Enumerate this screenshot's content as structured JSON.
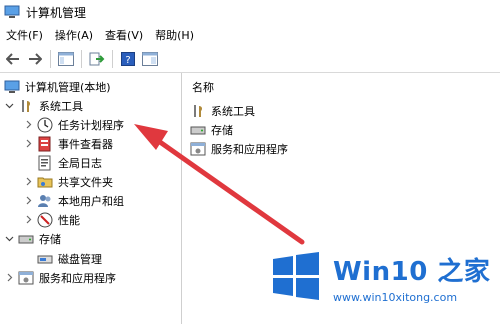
{
  "window": {
    "title": "计算机管理"
  },
  "menu": [
    {
      "label": "文件(F)"
    },
    {
      "label": "操作(A)"
    },
    {
      "label": "查看(V)"
    },
    {
      "label": "帮助(H)"
    }
  ],
  "toolbar": [
    {
      "name": "back-icon"
    },
    {
      "name": "forward-icon"
    },
    {
      "name": "show-hide-tree-icon"
    },
    {
      "name": "export-list-icon"
    },
    {
      "name": "help-icon"
    },
    {
      "name": "properties-pane-icon"
    }
  ],
  "tree": {
    "root": {
      "label": "计算机管理(本地)"
    },
    "system_tools": {
      "label": "系统工具"
    },
    "task_scheduler": {
      "label": "任务计划程序"
    },
    "event_viewer": {
      "label": "事件查看器"
    },
    "global_log": {
      "label": "全局日志"
    },
    "shared_folders": {
      "label": "共享文件夹"
    },
    "local_users": {
      "label": "本地用户和组"
    },
    "performance": {
      "label": "性能"
    },
    "storage": {
      "label": "存储"
    },
    "disk_management": {
      "label": "磁盘管理"
    },
    "services_apps": {
      "label": "服务和应用程序"
    }
  },
  "list": {
    "header": "名称",
    "items": [
      {
        "label": "系统工具"
      },
      {
        "label": "存储"
      },
      {
        "label": "服务和应用程序"
      }
    ]
  },
  "annotation": {
    "arrow_color": "#e0383e"
  },
  "watermark": {
    "brand": "Win10 之家",
    "url": "www.win10xitong.com",
    "color": "#1f6fd1"
  }
}
